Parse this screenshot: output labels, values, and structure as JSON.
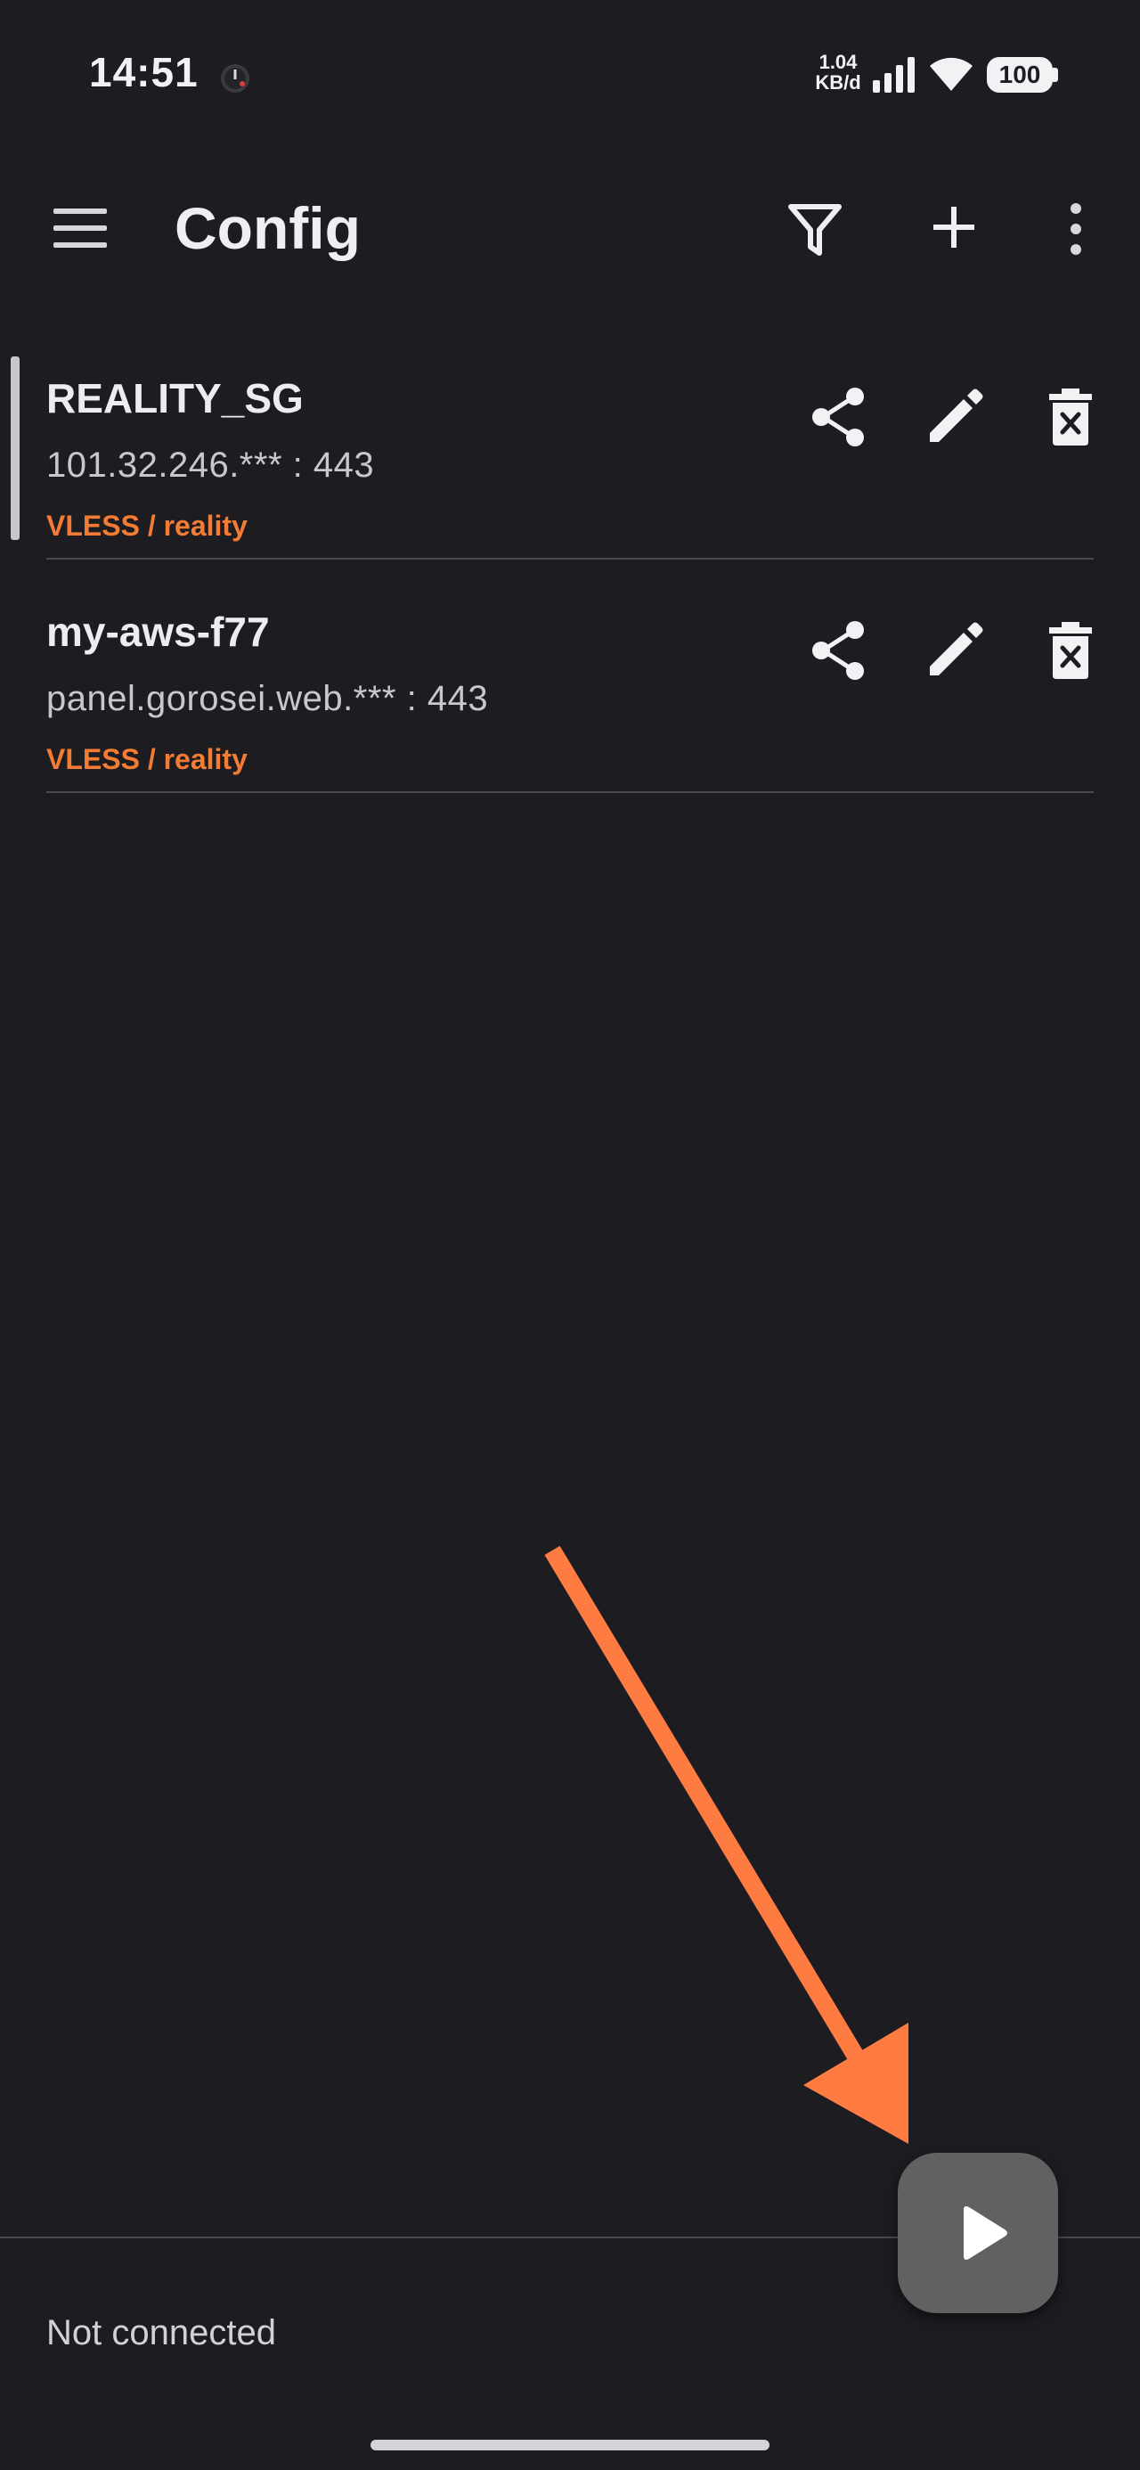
{
  "status_bar": {
    "time": "14:51",
    "net_speed_value": "1.04",
    "net_speed_unit": "KB/d",
    "battery": "100",
    "icons": [
      "alarm-icon",
      "signal-icon",
      "wifi-icon",
      "battery-icon"
    ]
  },
  "toolbar": {
    "title": "Config",
    "icons": [
      "menu-icon",
      "filter-icon",
      "add-icon",
      "more-icon"
    ]
  },
  "configs": [
    {
      "name": "REALITY_SG",
      "address": "101.32.246.*** : 443",
      "type": "VLESS / reality",
      "selected": true
    },
    {
      "name": "my-aws-f77",
      "address": "panel.gorosei.web.*** : 443",
      "type": "VLESS / reality",
      "selected": false
    }
  ],
  "item_actions": [
    "share-icon",
    "edit-icon",
    "delete-icon"
  ],
  "footer": {
    "status": "Not connected",
    "fab_icon": "play-icon"
  },
  "colors": {
    "background": "#1d1c21",
    "accent_orange": "#f47b33",
    "fab": "#616161",
    "annotation_arrow": "#fe7c42"
  }
}
